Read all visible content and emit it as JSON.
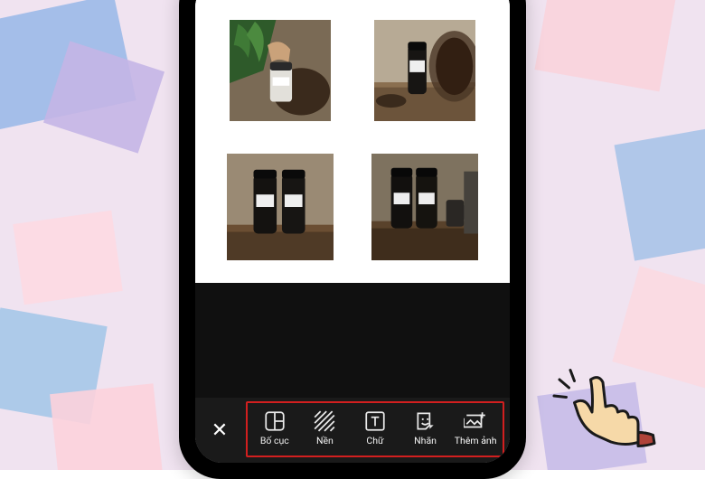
{
  "toolbar": {
    "close_label": "✕",
    "items": [
      {
        "id": "layout",
        "label": "Bố cục",
        "icon": "layout-icon"
      },
      {
        "id": "background",
        "label": "Nền",
        "icon": "pattern-icon"
      },
      {
        "id": "text",
        "label": "Chữ",
        "icon": "text-icon"
      },
      {
        "id": "sticker",
        "label": "Nhãn",
        "icon": "sticker-icon"
      },
      {
        "id": "add-image",
        "label": "Thêm ảnh",
        "icon": "add-image-icon"
      }
    ],
    "highlighted_index": 4
  },
  "canvas": {
    "layout": "2x2",
    "images": [
      {
        "pos": "top-left",
        "desc": "hand holding jar with green leaves and coffee beans"
      },
      {
        "pos": "top-right",
        "desc": "single bottle on wooden tray with coffee beans jar"
      },
      {
        "pos": "bottom-left",
        "desc": "two dark bottles on wooden shelf front view"
      },
      {
        "pos": "bottom-right",
        "desc": "two dark bottles with mug on weathered shelf"
      }
    ]
  },
  "annotation": {
    "highlight_box_color": "#d21f1f",
    "pointer": "pointing-hand"
  }
}
